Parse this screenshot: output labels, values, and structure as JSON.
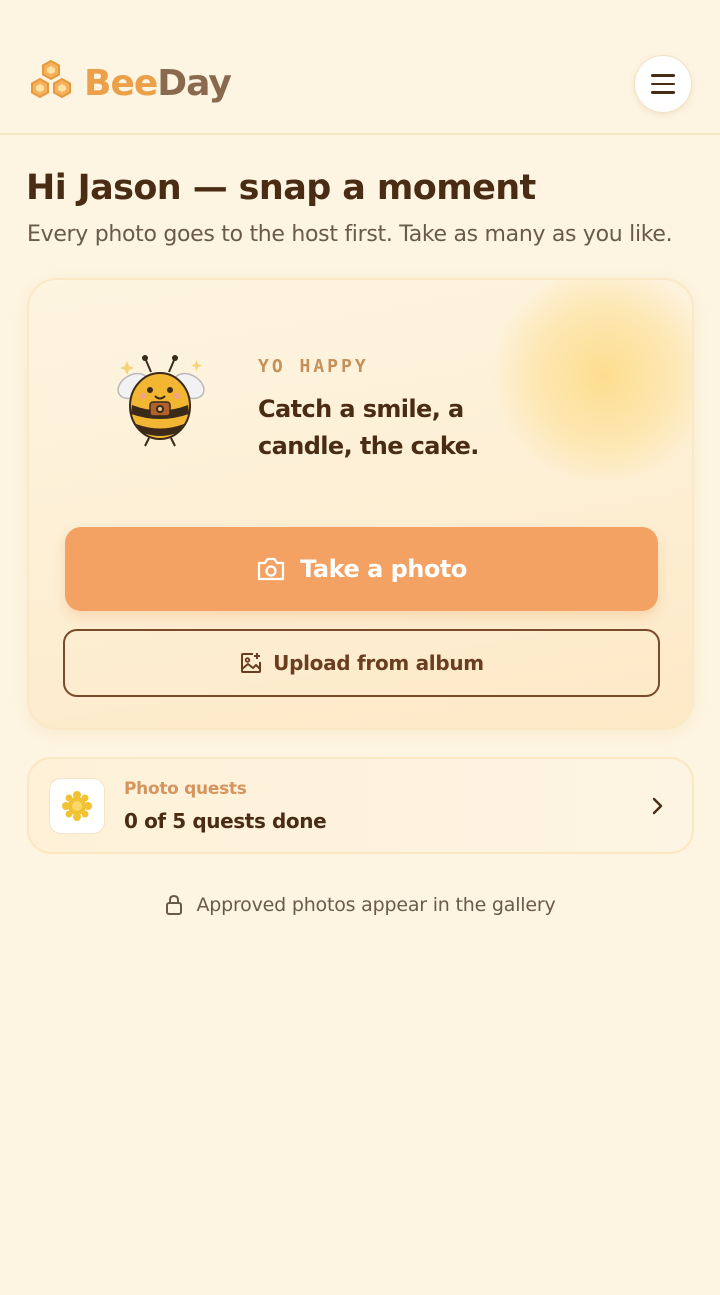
{
  "app": {
    "brand_part1": "Bee",
    "brand_part2": "Day",
    "brand_color": "#eca04a",
    "menu_icon": "menu-icon"
  },
  "greeting": {
    "title": "Hi Jason — snap a moment",
    "subtitle": "Every photo goes to the host first. Take as many as you like."
  },
  "hero": {
    "eyebrow": "YO HAPPY",
    "tagline": "Catch a smile, a candle, the cake.",
    "primary_button": "Take a photo",
    "primary_icon": "camera-icon",
    "secondary_button": "Upload from album",
    "secondary_icon": "image-plus-icon",
    "accent_color": "#f3a263"
  },
  "quests": {
    "label": "Photo quests",
    "status": "0 of 5 quests done",
    "icon": "sparkle-icon"
  },
  "footnote": {
    "text": "Approved photos appear in the gallery",
    "icon": "lock-icon"
  }
}
